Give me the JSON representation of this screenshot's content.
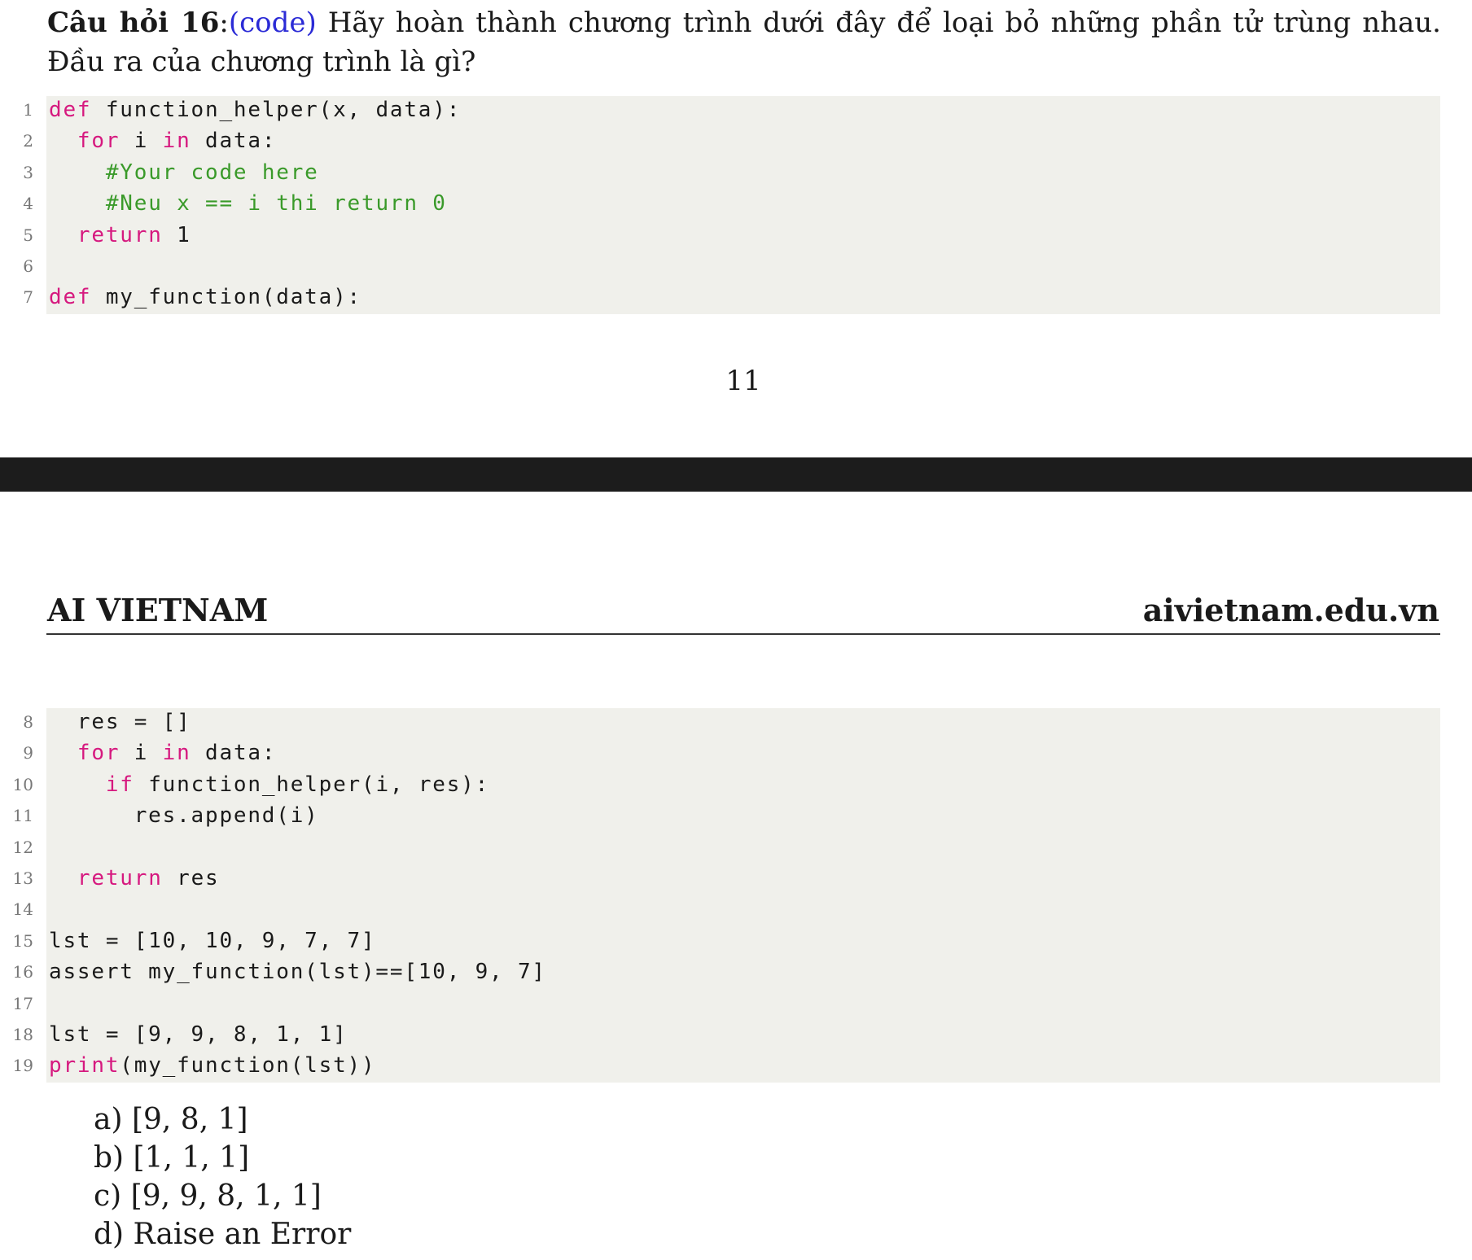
{
  "question": {
    "number_label": "Câu hỏi 16",
    "colon": ":",
    "tag": "(code)",
    "text": " Hãy hoàn thành chương trình dưới đây để loại bỏ những phần tử trùng nhau. Đầu ra của chương trình là gì?"
  },
  "code_part1": [
    {
      "num": "1",
      "tokens": [
        {
          "t": "def",
          "c": "kw"
        },
        {
          "t": " function_helper(x, data):"
        }
      ]
    },
    {
      "num": "2",
      "tokens": [
        {
          "t": "  "
        },
        {
          "t": "for",
          "c": "kw"
        },
        {
          "t": " i "
        },
        {
          "t": "in",
          "c": "kw"
        },
        {
          "t": " data:"
        }
      ]
    },
    {
      "num": "3",
      "tokens": [
        {
          "t": "    "
        },
        {
          "t": "#Your code here",
          "c": "cm"
        }
      ]
    },
    {
      "num": "4",
      "tokens": [
        {
          "t": "    "
        },
        {
          "t": "#Neu x == i thi return 0",
          "c": "cm"
        }
      ]
    },
    {
      "num": "5",
      "tokens": [
        {
          "t": "  "
        },
        {
          "t": "return",
          "c": "kw"
        },
        {
          "t": " 1"
        }
      ]
    },
    {
      "num": "6",
      "tokens": []
    },
    {
      "num": "7",
      "tokens": [
        {
          "t": "def",
          "c": "kw"
        },
        {
          "t": " my_function(data):"
        }
      ]
    }
  ],
  "page_number": "11",
  "header": {
    "left": "AI VIETNAM",
    "right": "aivietnam.edu.vn"
  },
  "code_part2": [
    {
      "num": "8",
      "tokens": [
        {
          "t": "  res = []"
        }
      ]
    },
    {
      "num": "9",
      "tokens": [
        {
          "t": "  "
        },
        {
          "t": "for",
          "c": "kw"
        },
        {
          "t": " i "
        },
        {
          "t": "in",
          "c": "kw"
        },
        {
          "t": " data:"
        }
      ]
    },
    {
      "num": "10",
      "tokens": [
        {
          "t": "    "
        },
        {
          "t": "if",
          "c": "kw"
        },
        {
          "t": " function_helper(i, res):"
        }
      ]
    },
    {
      "num": "11",
      "tokens": [
        {
          "t": "      res.append(i)"
        }
      ]
    },
    {
      "num": "12",
      "tokens": []
    },
    {
      "num": "13",
      "tokens": [
        {
          "t": "  "
        },
        {
          "t": "return",
          "c": "kw"
        },
        {
          "t": " res"
        }
      ]
    },
    {
      "num": "14",
      "tokens": []
    },
    {
      "num": "15",
      "tokens": [
        {
          "t": "lst = [10, 10, 9, 7, 7]"
        }
      ]
    },
    {
      "num": "16",
      "tokens": [
        {
          "t": "assert my_function(lst)==[10, 9, 7]"
        }
      ]
    },
    {
      "num": "17",
      "tokens": []
    },
    {
      "num": "18",
      "tokens": [
        {
          "t": "lst = [9, 9, 8, 1, 1]"
        }
      ]
    },
    {
      "num": "19",
      "tokens": [
        {
          "t": "print",
          "c": "kw"
        },
        {
          "t": "(my_function(lst))"
        }
      ]
    }
  ],
  "options": [
    "a) [9, 8, 1]",
    "b) [1, 1, 1]",
    "c) [9, 9, 8, 1, 1]",
    "d) Raise an Error"
  ]
}
